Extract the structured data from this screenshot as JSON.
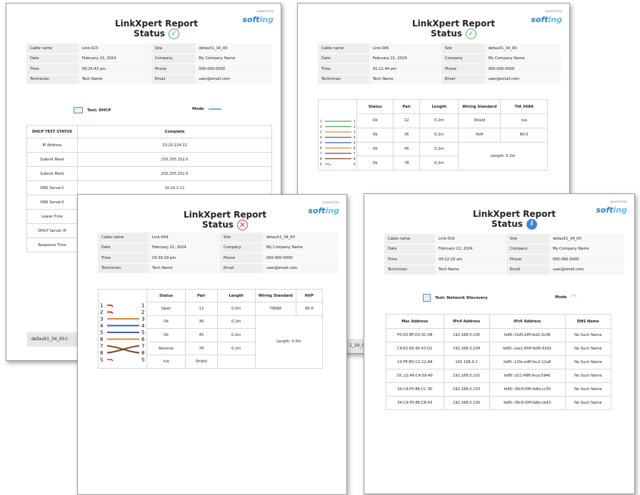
{
  "brand": {
    "pre": "powered by",
    "name_a": "soft",
    "name_b": "ing"
  },
  "reports": {
    "r1": {
      "title_line1": "LinkXpert Report",
      "title_line2": "Status",
      "info": [
        [
          "Cable name",
          "Link-023",
          "Site",
          "default1_34_00"
        ],
        [
          "Date",
          "February 22, 2024",
          "Company",
          "My Company Name"
        ],
        [
          "Time",
          "09:25:43 am",
          "Phone",
          "000-000-0000"
        ],
        [
          "Technician",
          "Tech Name",
          "Email",
          "user@email.com"
        ]
      ],
      "test_label": "Test: DHCP",
      "mode_label": "Mode",
      "table_header": [
        "DHCP TEST STATUS",
        "Complete"
      ],
      "rows": [
        [
          "IP Address",
          "10.20.224.12"
        ],
        [
          "Subnet Mask",
          "255.255.252.0"
        ],
        [
          "Subnet Mask",
          "255.255.252.0"
        ],
        [
          "DNS Server1",
          "10.10.2.11"
        ],
        [
          "DNS Server2",
          ""
        ],
        [
          "Lease Time",
          ""
        ],
        [
          "DHCP Server IP",
          ""
        ],
        [
          "Response Time",
          ""
        ]
      ],
      "footer": "default1_34_00.t"
    },
    "r2": {
      "title_line1": "LinkXpert Report",
      "title_line2": "Status",
      "info": [
        [
          "Cable name",
          "Link-006",
          "Site",
          "default1_34_00"
        ],
        [
          "Date",
          "February 21, 2024",
          "Company",
          "My Company Name"
        ],
        [
          "Time",
          "01:11:44 pm",
          "Phone",
          "000-000-0000"
        ],
        [
          "Technician",
          "Tech Name",
          "Email",
          "user@email.com"
        ]
      ],
      "headers": [
        "Status",
        "Pair",
        "Length",
        "Wiring Standard",
        "TIA 568A"
      ],
      "rows": [
        [
          "Ok",
          "12",
          "0.2m"
        ],
        [
          "Ok",
          "36",
          "0.2m"
        ],
        [
          "Ok",
          "45",
          "0.2m"
        ],
        [
          "Ok",
          "78",
          "0.2m"
        ]
      ],
      "side": [
        [
          "Shield",
          "n/a"
        ],
        [
          "NVP",
          "80.0"
        ]
      ],
      "length_note": "Length: 0.2m",
      "footer": "1_34_00."
    },
    "r3": {
      "title_line1": "LinkXpert Report",
      "title_line2": "Status",
      "info": [
        [
          "Cable name",
          "Link-004",
          "Site",
          "default1_34_00"
        ],
        [
          "Date",
          "February 22, 2024",
          "Company",
          "My Company Name"
        ],
        [
          "Time",
          "03:30:19 pm",
          "Phone",
          "000-000-0000"
        ],
        [
          "Technician",
          "Tech Name",
          "Email",
          "user@email.com"
        ]
      ],
      "headers": [
        "Status",
        "Pair",
        "Length",
        "Wiring Standard",
        "NVP"
      ],
      "rows": [
        [
          "Open",
          "12",
          "0.0m"
        ],
        [
          "Ok",
          "36",
          "0.2m"
        ],
        [
          "Ok",
          "45",
          "0.2m"
        ],
        [
          "Reverse",
          "78",
          "0.2m"
        ],
        [
          "n/a",
          "Shield",
          ""
        ]
      ],
      "standard": "T568A",
      "nvp": "80.0",
      "length_note": "Length: 0.0m"
    },
    "r4": {
      "title_line1": "LinkXpert Report",
      "title_line2": "Status",
      "info": [
        [
          "Cable name",
          "Link-019",
          "Site",
          "default1_34_00"
        ],
        [
          "Date",
          "February 22, 2024",
          "Company",
          "My Company Name"
        ],
        [
          "Time",
          "09:12:19 am",
          "Phone",
          "000-000-0000"
        ],
        [
          "Technician",
          "Tech Name",
          "Email",
          "user@email.com"
        ]
      ],
      "test_label": "Test: Network Discovery",
      "mode_label": "Mode",
      "headers": [
        "Mac Address",
        "IPv4 Address",
        "IPv6 Address",
        "DNS Name"
      ],
      "rows": [
        [
          "F0:D5:BF:D2:5C:08",
          "192.168.0.105",
          "fe80::f2d5:bfff:fed2:5c08",
          "No Such Name"
        ],
        [
          "C8:E2:65:95:43:D1",
          "192.168.0.104",
          "fe80::cae2:65ff:fe95:43d1",
          "No Such Name"
        ],
        [
          "10:FE:ED:C2:12:A8",
          "192.168.0.1",
          "fe80::12fe:edff:fec2:12a8",
          "No Such Name"
        ],
        [
          "DC:21:48:CA:59:40",
          "192.168.0.102",
          "fe80::d21:48ff:feca:5940",
          "No Such Name"
        ],
        [
          "34:C9:F0:8E:CC:30",
          "192.168.0.103",
          "fe80::36c9:f0ff:fe8e:cc30",
          "No Such Name"
        ],
        [
          "34:C9:F0:8E:CB:43",
          "192.168.0.100",
          "fe80::36c9:f0ff:fe8e:cb43",
          "No Such Name"
        ]
      ]
    }
  },
  "pin_numbers": [
    "1",
    "2",
    "3",
    "4",
    "5",
    "6",
    "7",
    "8",
    "S"
  ],
  "colors": {
    "pass": "#4aa85a",
    "fail": "#e03c3c",
    "info": "#3b87d6",
    "logo": "#2e7fc4"
  }
}
